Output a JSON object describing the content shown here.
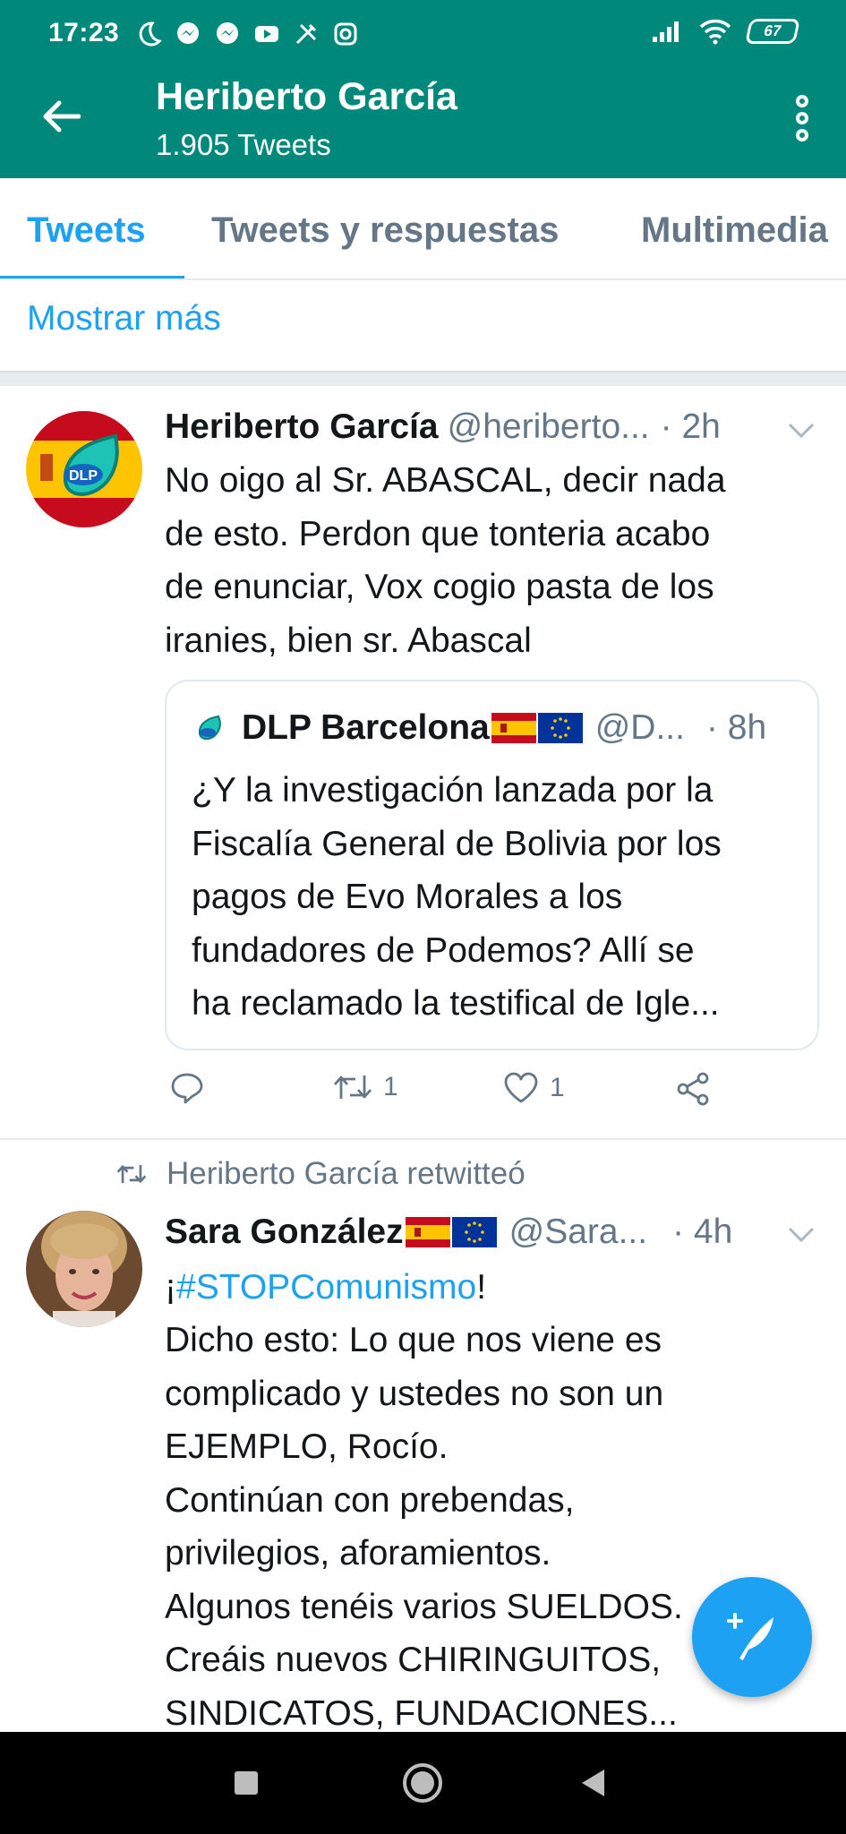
{
  "status_bar": {
    "time": "17:23",
    "battery": "67",
    "icons": [
      "moon-icon",
      "messenger-icon",
      "messenger-icon",
      "youtube-icon",
      "tools-icon",
      "instagram-icon",
      "signal-icon",
      "wifi-icon",
      "battery-icon"
    ]
  },
  "header": {
    "title": "Heriberto García",
    "subtitle": "1.905 Tweets",
    "bg_color": "#00897b"
  },
  "tabs": [
    {
      "label": "Tweets",
      "active": true
    },
    {
      "label": "Tweets y respuestas",
      "active": false
    },
    {
      "label": "Multimedia",
      "active": false
    }
  ],
  "show_more": "Mostrar más",
  "tweet1": {
    "name": "Heriberto García",
    "handle": "@heriberto...",
    "time": "· 2h",
    "text": "No oigo al Sr. ABASCAL, decir nada\nde esto. Perdon que tonteria acabo\nde enunciar, Vox cogio pasta de los\niranies, bien sr. Abascal",
    "avatar_text": "DLP",
    "quote": {
      "name": "DLP Barcelona",
      "handle": "@D...",
      "time": "· 8h",
      "text": "¿Y la investigación lanzada por la\nFiscalía General de Bolivia por los\npagos de Evo Morales a los\nfundadores de Podemos? Allí se\nha reclamado la testifical de Igle..."
    },
    "retweets": "1",
    "likes": "1"
  },
  "tweet2": {
    "retweeted_by": "Heriberto García retwitteó",
    "name": "Sara González",
    "handle": "@Sara...",
    "time": "· 4h",
    "hashtag": "#STOPComunismo",
    "text_prefix": "¡",
    "text_suffix": "!",
    "text": "Dicho esto: Lo que nos viene es\ncomplicado y ustedes no son un\nEJEMPLO, Rocío.\nContinúan con prebendas,\nprivilegios, aforamientos.\nAlgunos tenéis varios SUELDOS.\nCreáis nuevos CHIRINGUITOS,\nSINDICATOS, FUNDACIONES..."
  },
  "accent_color": "#1da1f2"
}
